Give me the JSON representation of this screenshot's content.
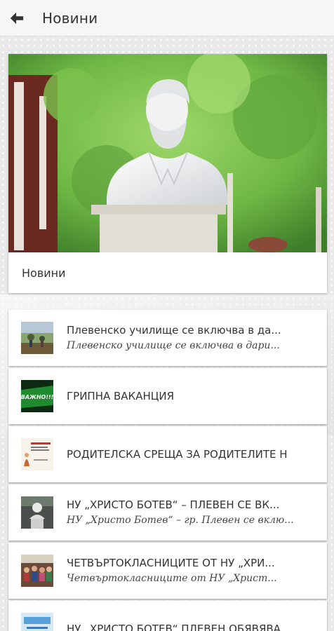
{
  "app_bar": {
    "title": "Новини",
    "back_icon": "arrow-left-icon"
  },
  "hero": {
    "caption": "Новини"
  },
  "news_items": [
    {
      "title": "Плевенско училище се включва в да...",
      "subtitle": "Плевенско училище се включва в дари...",
      "thumb": "field-photo"
    },
    {
      "title": "ГРИПНА ВАКАНЦИЯ",
      "subtitle": "",
      "thumb": "important-green",
      "thumb_text": "ВАЖНО!!!"
    },
    {
      "title": "РОДИТЕЛСКА СРЕЩА ЗА РОДИТЕЛИТЕ Н",
      "subtitle": "",
      "thumb": "poster"
    },
    {
      "title": "НУ „ХРИСТО БОТЕВ“ – ПЛЕВЕН СЕ ВК...",
      "subtitle": "НУ „Христо Ботев“ – гр. Плевен се вклю...",
      "thumb": "monument-photo"
    },
    {
      "title": "ЧЕТВЪРТОКЛАСНИЦИТЕ ОТ НУ „ХРИ...",
      "subtitle": "Четвъртокласниците от НУ „Христ...",
      "thumb": "class-photo"
    },
    {
      "title": "НУ „ХРИСТО БОТЕВ“ ПЛЕВЕН ОБЯВЯВА",
      "subtitle": "",
      "thumb": "blue-photo"
    }
  ],
  "colors": {
    "background": "#e9e9ea",
    "appbar": "#f6f6f6",
    "card": "#ffffff",
    "important_green": "#1f8a2e"
  }
}
